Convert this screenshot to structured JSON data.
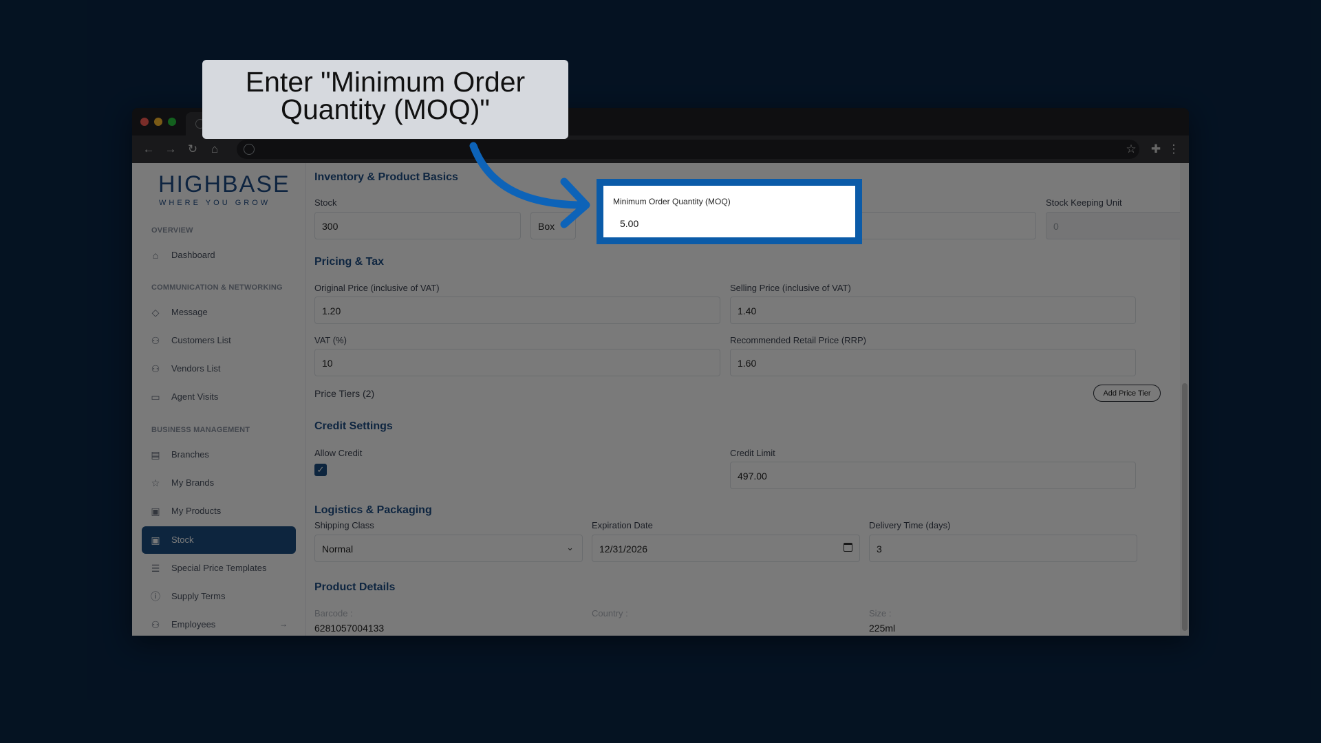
{
  "callout": {
    "text": "Enter \"Minimum Order Quantity (MOQ)\""
  },
  "brand": {
    "name": "HIGHBASE",
    "tagline": "WHERE YOU GROW"
  },
  "sidebar": {
    "sections": [
      {
        "label": "OVERVIEW"
      },
      {
        "label": "COMMUNICATION & NETWORKING"
      },
      {
        "label": "BUSINESS MANAGEMENT"
      }
    ],
    "items": [
      {
        "label": "Dashboard",
        "icon": "home-icon"
      },
      {
        "label": "Message",
        "icon": "message-icon"
      },
      {
        "label": "Customers List",
        "icon": "users-icon"
      },
      {
        "label": "Vendors List",
        "icon": "users-icon"
      },
      {
        "label": "Agent Visits",
        "icon": "truck-icon"
      },
      {
        "label": "Branches",
        "icon": "store-icon"
      },
      {
        "label": "My Brands",
        "icon": "star-icon"
      },
      {
        "label": "My Products",
        "icon": "box-icon"
      },
      {
        "label": "Stock",
        "icon": "archive-icon",
        "active": true
      },
      {
        "label": "Special Price Templates",
        "icon": "list-icon"
      },
      {
        "label": "Supply Terms",
        "icon": "info-icon"
      },
      {
        "label": "Employees",
        "icon": "team-icon"
      }
    ]
  },
  "form": {
    "inventory": {
      "title": "Inventory & Product Basics",
      "stock_label": "Stock",
      "stock_value": "300",
      "unit_value": "Box",
      "moq_label": "Minimum Order Quantity (MOQ)",
      "moq_value": "5.00",
      "sku_label": "Stock Keeping Unit",
      "sku_value": "0"
    },
    "pricing": {
      "title": "Pricing & Tax",
      "original_label": "Original Price (inclusive of VAT)",
      "original_value": "1.20",
      "selling_label": "Selling Price (inclusive of VAT)",
      "selling_value": "1.40",
      "vat_label": "VAT (%)",
      "vat_value": "10",
      "rrp_label": "Recommended Retail Price (RRP)",
      "rrp_value": "1.60",
      "tiers_label": "Price Tiers (2)",
      "add_tier_label": "Add Price Tier"
    },
    "credit": {
      "title": "Credit Settings",
      "allow_label": "Allow Credit",
      "allow_checked": true,
      "limit_label": "Credit Limit",
      "limit_value": "497.00"
    },
    "logistics": {
      "title": "Logistics & Packaging",
      "shipping_label": "Shipping Class",
      "shipping_value": "Normal",
      "expiry_label": "Expiration Date",
      "expiry_value": "12/31/2026",
      "delivery_label": "Delivery Time (days)",
      "delivery_value": "3"
    },
    "details": {
      "title": "Product Details",
      "barcode_label": "Barcode :",
      "barcode_value": "6281057004133",
      "country_label": "Country :",
      "size_label": "Size :",
      "size_value": "225ml"
    }
  },
  "colors": {
    "background": "#0b2748",
    "accent": "#1d4f82",
    "highlight": "#0b5ba8"
  }
}
